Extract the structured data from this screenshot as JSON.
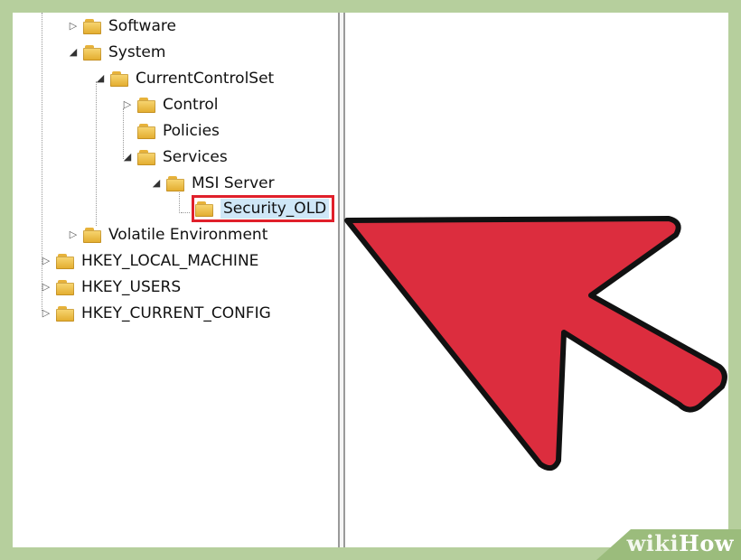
{
  "registry_tree": {
    "items": [
      {
        "label": "Software",
        "expander": "collapsed"
      },
      {
        "label": "System",
        "expander": "expanded"
      },
      {
        "label": "CurrentControlSet",
        "expander": "expanded"
      },
      {
        "label": "Control",
        "expander": "collapsed"
      },
      {
        "label": "Policies",
        "expander": "none"
      },
      {
        "label": "Services",
        "expander": "expanded"
      },
      {
        "label": "MSI Server",
        "expander": "expanded"
      },
      {
        "label": "Security_OLD",
        "expander": "none",
        "selected": true,
        "highlighted": true
      },
      {
        "label": "Volatile Environment",
        "expander": "collapsed"
      },
      {
        "label": "HKEY_LOCAL_MACHINE",
        "expander": "collapsed"
      },
      {
        "label": "HKEY_USERS",
        "expander": "collapsed"
      },
      {
        "label": "HKEY_CURRENT_CONFIG",
        "expander": "collapsed"
      }
    ]
  },
  "annotation": {
    "color": "#dc2d3e",
    "outline": "#111111",
    "icon": "pointer-arrow"
  },
  "highlight": {
    "color": "#e0202b"
  },
  "watermark": {
    "wiki": "wiki",
    "how": "How"
  },
  "icons": {
    "folder": "folder-icon",
    "expand": "expand-triangle-icon",
    "collapse": "collapse-triangle-icon"
  }
}
